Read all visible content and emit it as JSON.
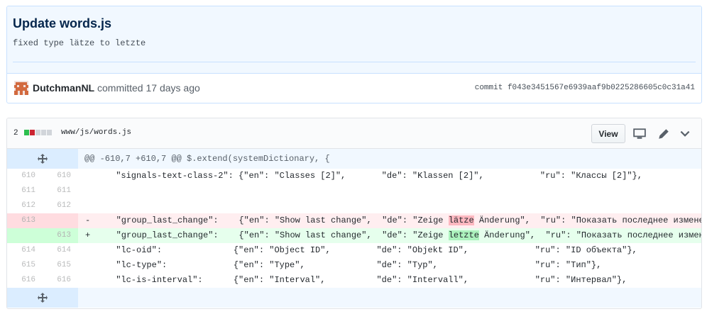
{
  "commit": {
    "title": "Update words.js",
    "description": "fixed type lätze to letzte",
    "author": "DutchmanNL",
    "action": "committed",
    "time": "17 days ago",
    "sha_label": "commit f043e3451567e6939aaf9b0225286605c0c31a41"
  },
  "file": {
    "changes": "2",
    "path": "www/js/words.js",
    "view_label": "View"
  },
  "colors": {
    "add": "#2cbe4e",
    "del": "#cb2431",
    "hunk_bg": "#f1f8ff",
    "add_bg": "#e6ffed",
    "del_bg": "#ffeef0"
  },
  "diff": {
    "hunk_header": "@@ -610,7 +610,7 @@ $.extend(systemDictionary, {",
    "lines": [
      {
        "old": "610",
        "new": "610",
        "type": "ctx",
        "text": "    \"signals-text-class-2\": {\"en\": \"Classes [2]\",       \"de\": \"Klassen [2]\",           \"ru\": \"Классы [2]\"},"
      },
      {
        "old": "611",
        "new": "611",
        "type": "ctx",
        "text": ""
      },
      {
        "old": "612",
        "new": "612",
        "type": "ctx",
        "text": ""
      },
      {
        "old": "613",
        "new": "",
        "type": "del",
        "marker": "-",
        "pre": "   \"group_last_change\":    {\"en\": \"Show last change\",  \"de\": \"Zeige ",
        "hl": "lätze",
        "post": " Änderung\",  \"ru\": \"Показать последнее изменение\"},"
      },
      {
        "old": "",
        "new": "613",
        "type": "add",
        "marker": "+",
        "pre": "   \"group_last_change\":    {\"en\": \"Show last change\",  \"de\": \"Zeige ",
        "hl": "letzte",
        "post": " Änderung\",  \"ru\": \"Показать последнее изменение\"},"
      },
      {
        "old": "614",
        "new": "614",
        "type": "ctx",
        "text": "    \"lc-oid\":              {\"en\": \"Object ID\",         \"de\": \"Objekt ID\",             \"ru\": \"ID объекта\"},"
      },
      {
        "old": "615",
        "new": "615",
        "type": "ctx",
        "text": "    \"lc-type\":             {\"en\": \"Type\",              \"de\": \"Typ\",                   \"ru\": \"Тип\"},"
      },
      {
        "old": "616",
        "new": "616",
        "type": "ctx",
        "text": "    \"lc-is-interval\":      {\"en\": \"Interval\",          \"de\": \"Intervall\",             \"ru\": \"Интервал\"},"
      }
    ]
  },
  "icons": {
    "expand": "unfold-icon",
    "desktop": "desktop-icon",
    "edit": "pencil-icon",
    "collapse": "chevron-down-icon",
    "avatar": "avatar-identicon"
  }
}
